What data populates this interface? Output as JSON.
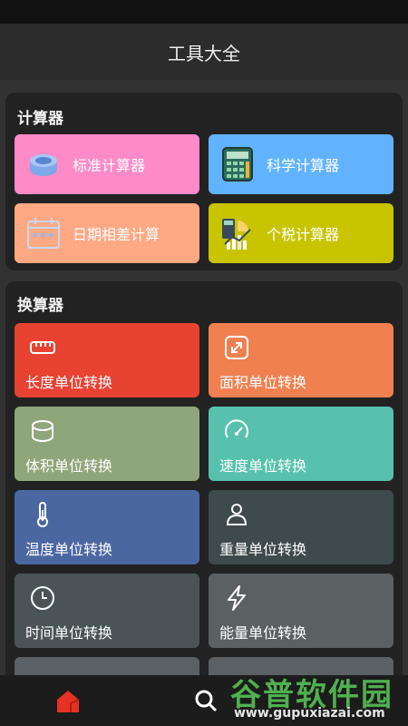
{
  "header": {
    "title": "工具大全"
  },
  "calculators": {
    "title": "计算器",
    "items": [
      {
        "label": "标准计算器",
        "color": "#ff8ac8"
      },
      {
        "label": "科学计算器",
        "color": "#62b3ff"
      },
      {
        "label": "日期相差计算",
        "color": "#ffa884"
      },
      {
        "label": "个税计算器",
        "color": "#c8c400"
      }
    ]
  },
  "converters": {
    "title": "换算器",
    "items": [
      {
        "label": "长度单位转换",
        "color": "#e84232",
        "icon": "ruler-icon"
      },
      {
        "label": "面积单位转换",
        "color": "#f08050",
        "icon": "resize-icon"
      },
      {
        "label": "体积单位转换",
        "color": "#8fa67a",
        "icon": "cube-icon"
      },
      {
        "label": "速度单位转换",
        "color": "#57c1ad",
        "icon": "gauge-icon"
      },
      {
        "label": "温度单位转换",
        "color": "#4b67a2",
        "icon": "thermometer-icon"
      },
      {
        "label": "重量单位转换",
        "color": "#3e4a4b",
        "icon": "weight-icon"
      },
      {
        "label": "时间单位转换",
        "color": "#4a5457",
        "icon": "clock-icon"
      },
      {
        "label": "能量单位转换",
        "color": "#5b6062",
        "icon": "lightning-icon"
      }
    ]
  },
  "bottom_nav": {
    "items": [
      "home-icon",
      "search-icon"
    ]
  },
  "watermark": {
    "brand": "谷普软件园",
    "url": "www.gupuxiazai.com"
  }
}
